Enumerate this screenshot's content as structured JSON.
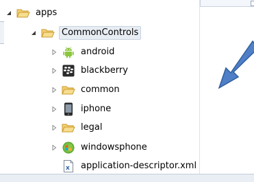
{
  "tree": {
    "root": {
      "label": "apps",
      "icon": "folder-open-icon",
      "expanded": true
    },
    "project": {
      "label": "CommonControls",
      "icon": "folder-open-icon",
      "expanded": true,
      "selected": true
    },
    "children": [
      {
        "label": "android",
        "icon": "android-icon",
        "expandable": true
      },
      {
        "label": "blackberry",
        "icon": "blackberry-icon",
        "expandable": true
      },
      {
        "label": "common",
        "icon": "folder-icon",
        "expandable": true
      },
      {
        "label": "iphone",
        "icon": "iphone-icon",
        "expandable": true
      },
      {
        "label": "legal",
        "icon": "folder-icon",
        "expandable": true
      },
      {
        "label": "windowsphone",
        "icon": "windowsphone-icon",
        "expandable": true
      },
      {
        "label": "application-descriptor.xml",
        "icon": "xml-file-icon",
        "expandable": false
      }
    ]
  },
  "annotation": {
    "icon": "blue-arrow-icon",
    "color": "#4f7fc6"
  }
}
